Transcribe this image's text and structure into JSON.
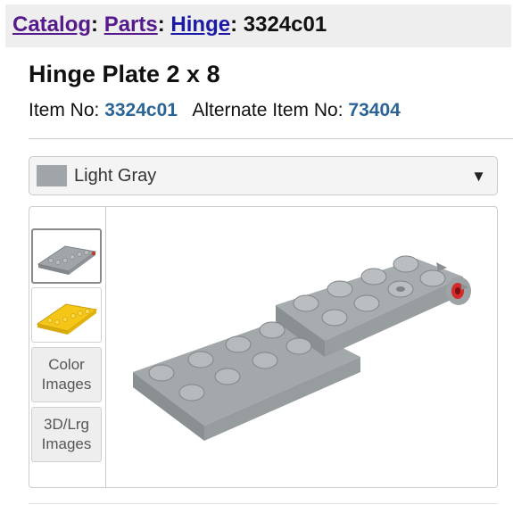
{
  "breadcrumb": {
    "items": [
      "Catalog",
      "Parts",
      "Hinge"
    ],
    "separator": ":",
    "current": "3324c01"
  },
  "item": {
    "title": "Hinge Plate 2 x 8",
    "item_no_label": "Item No:",
    "item_no": "3324c01",
    "alt_label": "Alternate Item No:",
    "alt_no": "73404"
  },
  "color_select": {
    "selected": "Light Gray",
    "swatch_color": "#a0a5a9",
    "caret": "▼"
  },
  "thumbnails": {
    "buttons": [
      "Color Images",
      "3D/Lrg Images"
    ]
  },
  "colors": {
    "link_visited": "#551a8b",
    "link": "#1a1aa6",
    "value": "#2a6496",
    "part_gray": "#a0a5a9",
    "part_yellow": "#f5c518"
  }
}
